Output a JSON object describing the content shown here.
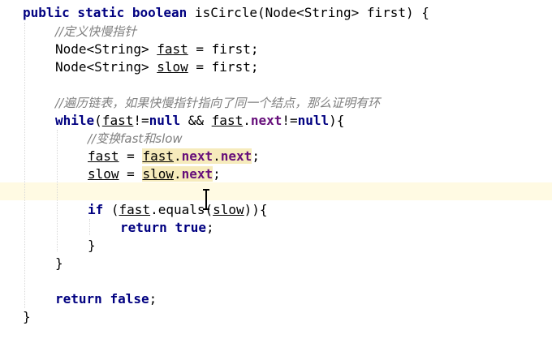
{
  "code": {
    "l1": {
      "kw": "public static boolean",
      "rest": " isCircle(Node<String> first) {"
    },
    "l2": {
      "comment": "//定义快慢指针"
    },
    "l3": {
      "type": "Node<String> ",
      "var": "fast",
      "rest": " = first;"
    },
    "l4": {
      "type": "Node<String> ",
      "var": "slow",
      "rest": " = first;"
    },
    "l6": {
      "comment": "//遍历链表，如果快慢指针指向了同一个结点，那么证明有环"
    },
    "l7": {
      "kw": "while",
      "p1": "(",
      "fast": "fast",
      "neq1": "!=",
      "null1": "null",
      "and": " && ",
      "fast2": "fast",
      "dot": ".",
      "next": "next",
      "neq2": "!=",
      "null2": "null",
      "end": "){"
    },
    "l8": {
      "comment": "//变换fast和slow"
    },
    "l9": {
      "var": "fast",
      "eq": " = ",
      "src": "fast",
      "d1": ".",
      "n1": "next",
      "d2": ".",
      "n2": "next",
      "semi": ";"
    },
    "l10": {
      "var": "slow",
      "eq": " = ",
      "src": "slow",
      "d1": ".",
      "n1": "next",
      "semi": ";"
    },
    "l12": {
      "kw": "if",
      "p1": " (",
      "fast": "fast",
      "mid": ".equals(",
      "slow": "slow",
      "end": ")){"
    },
    "l13": {
      "kw1": "return",
      "sp": " ",
      "kw2": "true",
      "semi": ";"
    },
    "l14": {
      "brace": "}"
    },
    "l15": {
      "brace": "}"
    },
    "l17": {
      "kw1": "return",
      "sp": " ",
      "kw2": "false",
      "semi": ";"
    },
    "l18": {
      "brace": "}"
    }
  }
}
